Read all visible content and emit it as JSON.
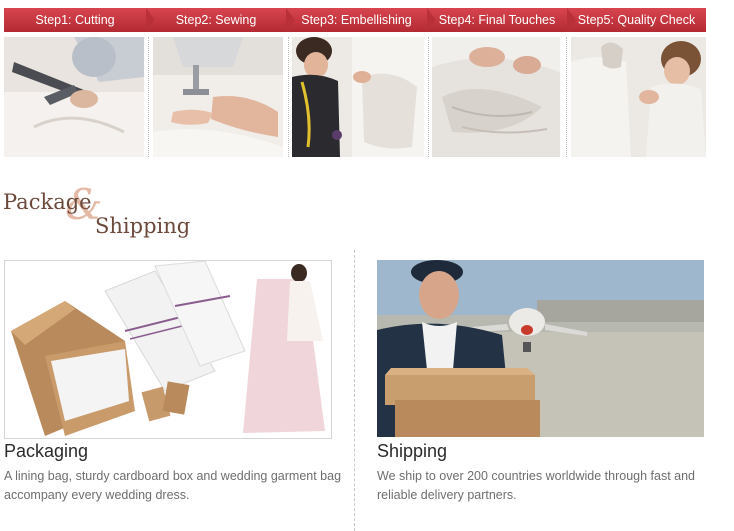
{
  "steps": [
    {
      "label": "Step1: Cutting"
    },
    {
      "label": "Step2: Sewing"
    },
    {
      "label": "Step3: Embellishing"
    },
    {
      "label": "Step4: Final Touches"
    },
    {
      "label": "Step5: Quality Check"
    }
  ],
  "heading": {
    "part1": "Package",
    "ampersand": "&",
    "part2": "Shipping"
  },
  "packaging": {
    "title": "Packaging",
    "description": "A lining bag, sturdy cardboard box and wedding garment bag accompany every wedding dress."
  },
  "shipping": {
    "title": "Shipping",
    "description": "We ship to over 200 countries worldwide through fast and reliable delivery partners."
  },
  "colors": {
    "step_bar": "#c13540",
    "heading": "#6b4a3c",
    "ampersand": "#e3b9a6",
    "body_text": "#6e6e6e"
  }
}
